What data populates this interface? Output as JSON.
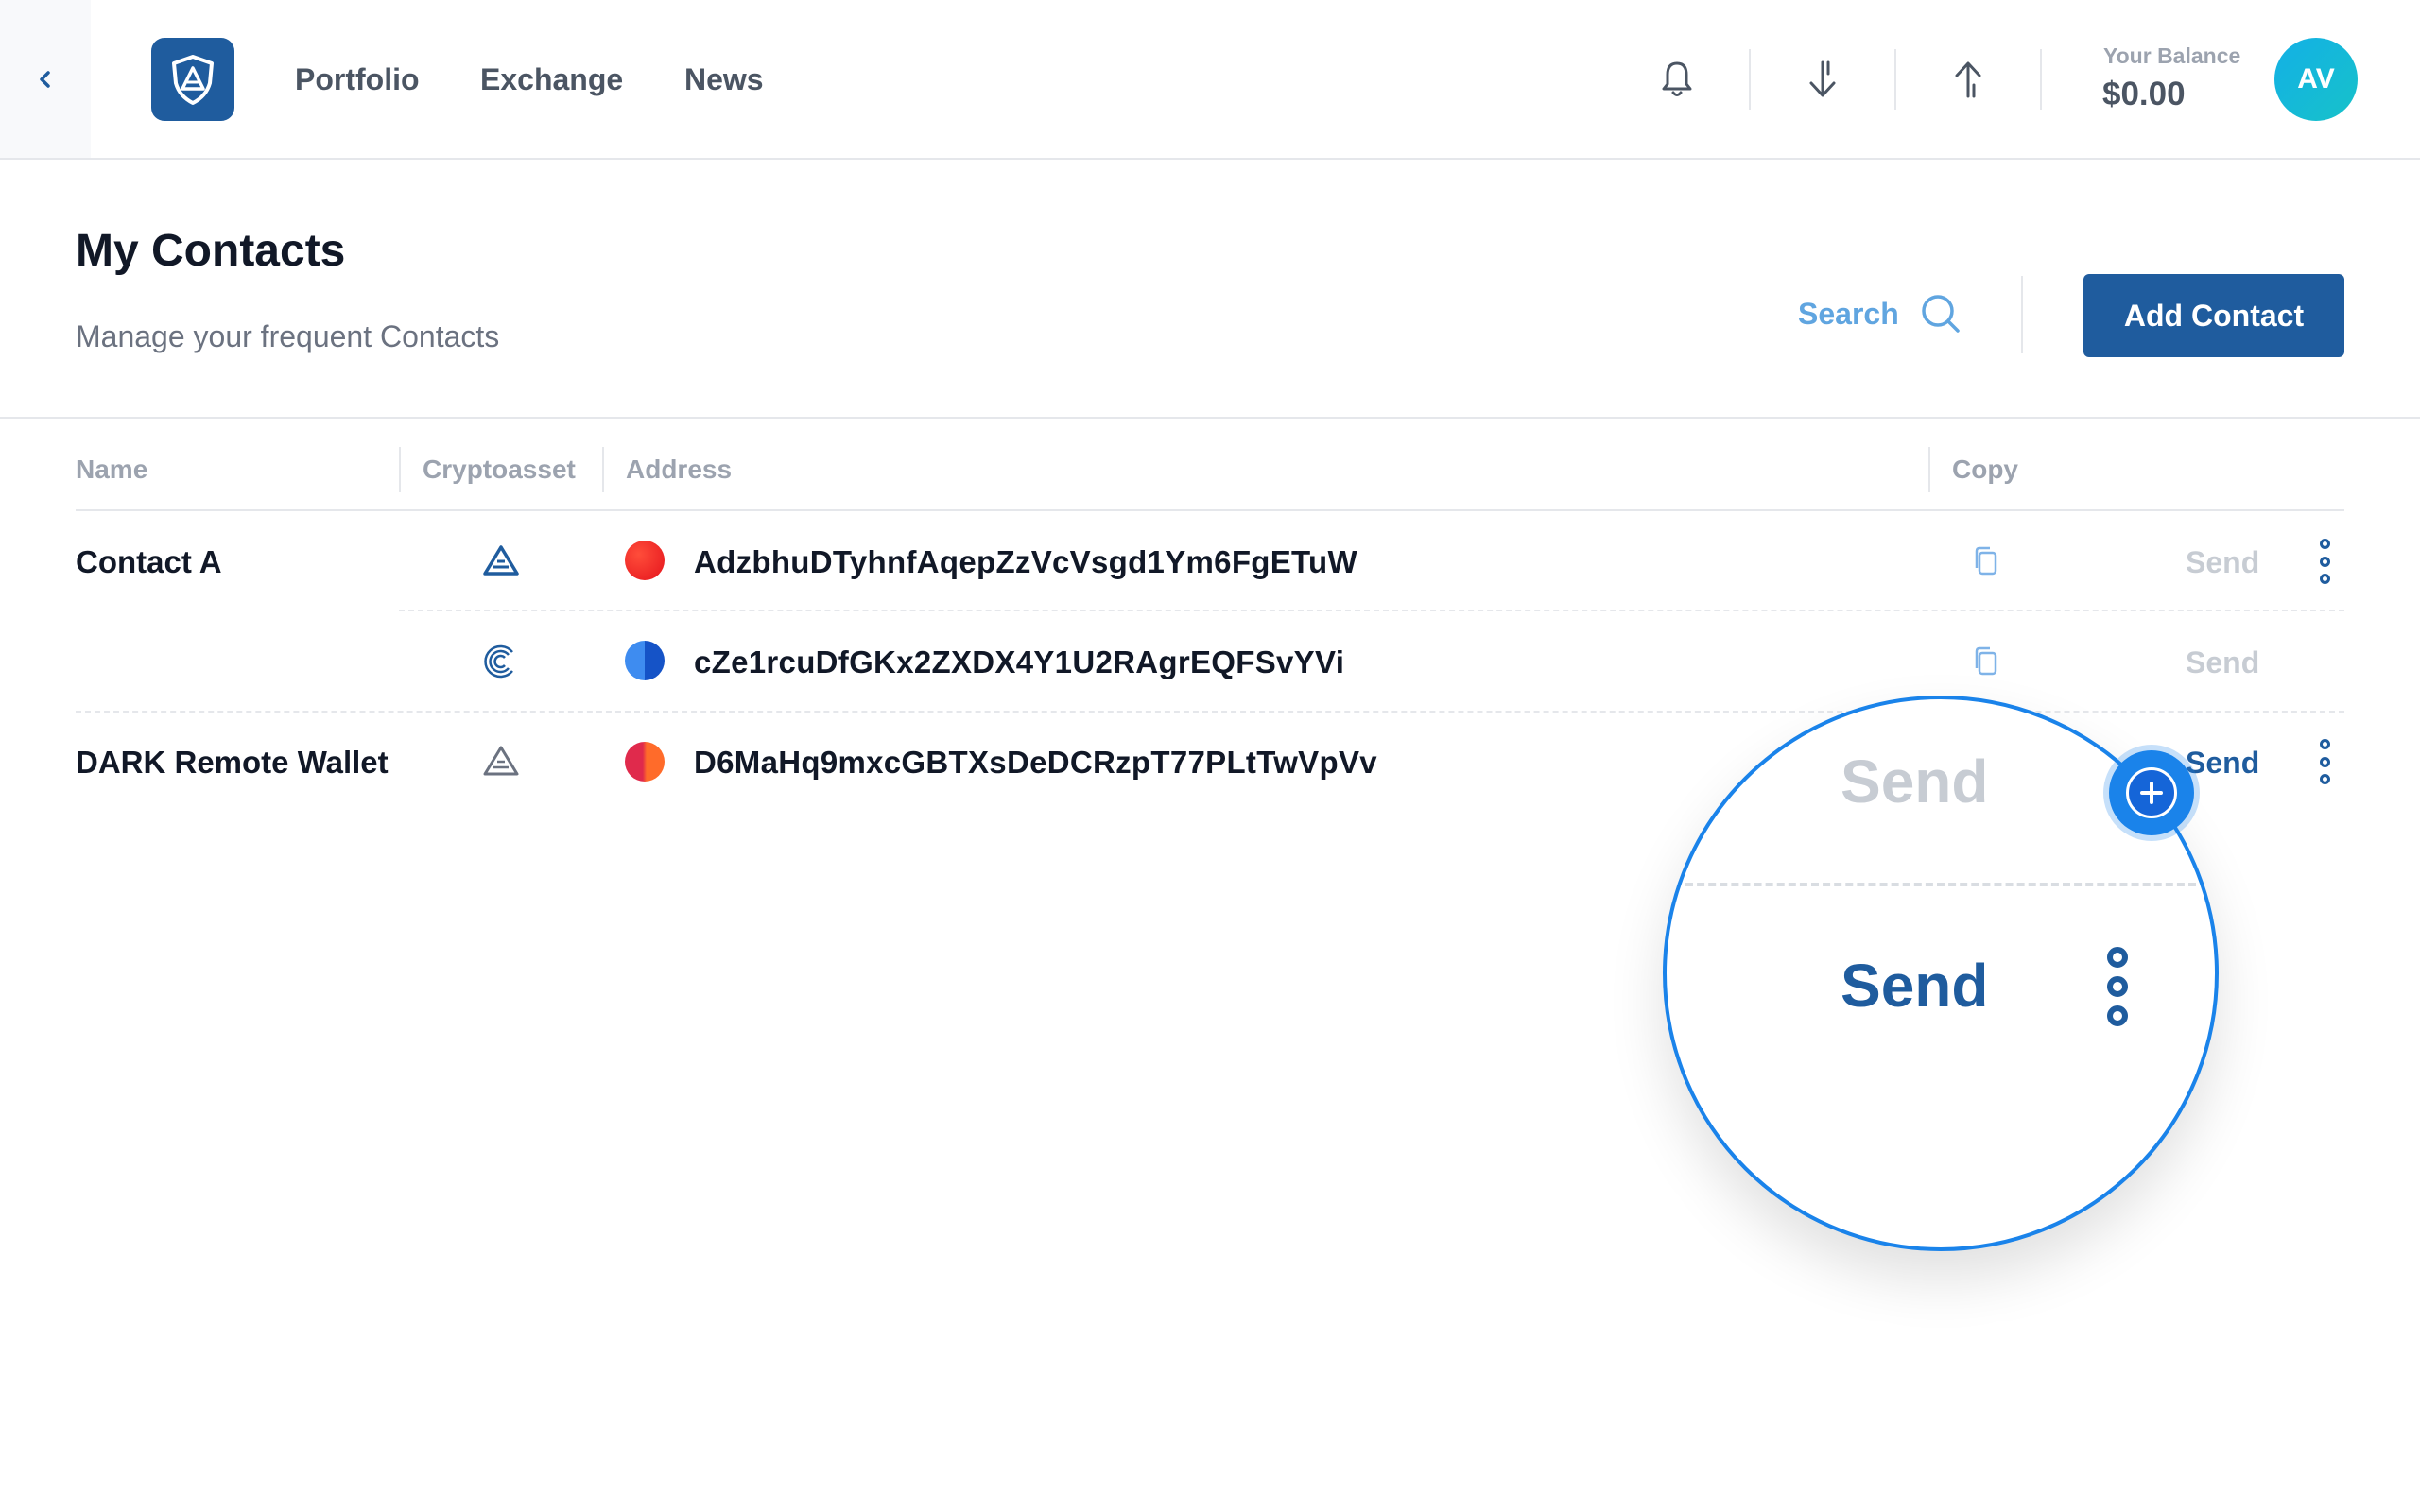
{
  "nav": {
    "links": {
      "portfolio": "Portfolio",
      "exchange": "Exchange",
      "news": "News"
    },
    "balance_label": "Your Balance",
    "balance_value": "$0.00",
    "avatar_initials": "AV",
    "icons": [
      "back-chevron-icon",
      "app-logo",
      "bell-icon",
      "receive-arrow-icon",
      "send-arrow-icon"
    ]
  },
  "page": {
    "title": "My Contacts",
    "subtitle": "Manage your frequent Contacts",
    "search_label": "Search",
    "add_button": "Add Contact"
  },
  "table": {
    "columns": {
      "name": "Name",
      "cryptoasset": "Cryptoasset",
      "address": "Address",
      "copy": "Copy"
    },
    "rows": [
      {
        "name": "Contact A",
        "asset_icon": "ark-icon",
        "coin_color": "#f4262a",
        "address": "AdzbhuDTyhnfAqepZzVcVsgd1Ym6FgETuW",
        "send": "Send",
        "send_state": "disabled",
        "has_menu": true
      },
      {
        "name": "",
        "asset_icon": "c-coin-icon",
        "coin_color": "#1f6fe0",
        "address": "cZe1rcuDfGKx2ZXDX4Y1U2RAgrEQFSvYVi",
        "send": "Send",
        "send_state": "disabled",
        "has_menu": false
      },
      {
        "name": "DARK Remote Wallet",
        "asset_icon": "ark-icon",
        "coin_color": "#f45a2a",
        "address": "D6MaHq9mxcGBTXsDeDCRzpT77PLtTwVpVv",
        "send": "Send",
        "send_state": "active",
        "has_menu": true
      }
    ]
  },
  "magnifier": {
    "top_label": "Send",
    "bottom_label": "Send"
  },
  "colors": {
    "brand": "#1f5c9e",
    "accent": "#1a83ea",
    "disabled": "#c7ccd3"
  }
}
